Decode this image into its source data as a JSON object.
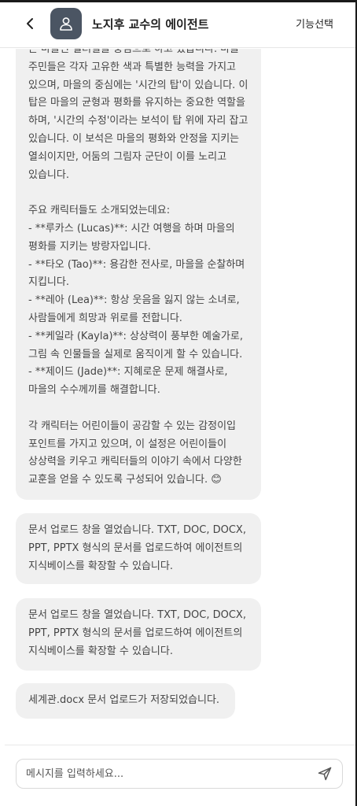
{
  "header": {
    "title": "노지후 교수의 에이전트",
    "feature_button": "기능선택"
  },
  "messages": [
    {
      "text": "는 마을인 컬러힐을 중심으로 하고 있습니다. 마을 주민들은 각자 고유한 색과 특별한 능력을 가지고 있으며, 마을의 중심에는 '시간의 탑'이 있습니다. 이 탑은 마을의 균형과 평화를 유지하는 중요한 역할을 하며, '시간의 수정'이라는 보석이 탑 위에 자리 잡고 있습니다. 이 보석은 마을의 평화와 안정을 지키는 열쇠이지만, 어둠의 그림자 군단이 이를 노리고 있습니다.\n\n주요 캐릭터들도 소개되었는데요:\n- **루카스 (Lucas)**: 시간 여행을 하며 마을의 평화를 지키는 방랑자입니다.\n- **타오 (Tao)**: 용감한 전사로, 마을을 순찰하며 지킵니다.\n- **레아 (Lea)**: 항상 웃음을 잃지 않는 소녀로, 사람들에게 희망과 위로를 전합니다.\n- **케일라 (Kayla)**: 상상력이 풍부한 예술가로, 그림 속 인물들을 실제로 움직이게 할 수 있습니다.\n- **제이드 (Jade)**: 지혜로운 문제 해결사로, 마을의 수수께끼를 해결합니다.\n\n각 캐릭터는 어린이들이 공감할 수 있는 감정이입 포인트를 가지고 있으며, 이 설정은 어린이들이 상상력을 키우고 캐릭터들의 이야기 속에서 다양한 교훈을 얻을 수 있도록 구성되어 있습니다. 😊"
    },
    {
      "text": "문서 업로드 창을 열었습니다. TXT, DOC, DOCX, PPT, PPTX 형식의 문서를 업로드하여 에이전트의 지식베이스를 확장할 수 있습니다."
    },
    {
      "text": "문서 업로드 창을 열었습니다. TXT, DOC, DOCX, PPT, PPTX 형식의 문서를 업로드하여 에이전트의 지식베이스를 확장할 수 있습니다."
    },
    {
      "text": "세계관.docx 문서 업로드가 저장되었습니다."
    }
  ],
  "composer": {
    "placeholder": "메시지를 입력하세요..."
  },
  "icons": {
    "back": "chevron-left-icon",
    "avatar": "user-icon",
    "send": "send-icon"
  },
  "colors": {
    "bubble_bg": "#f0f0f0",
    "avatar_bg": "#4b5563"
  }
}
